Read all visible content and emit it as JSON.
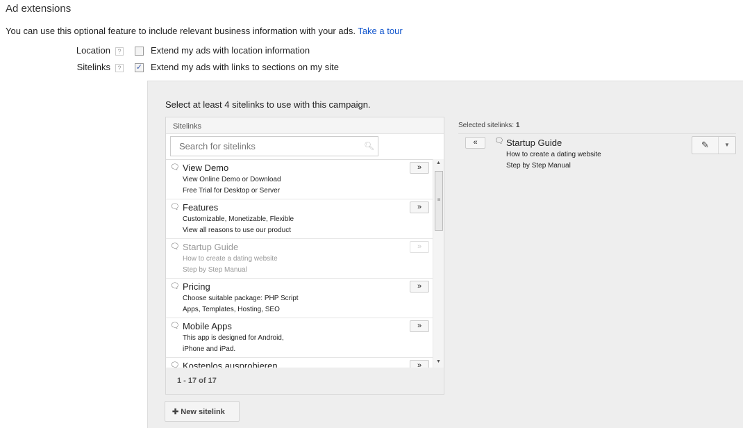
{
  "header": {
    "title": "Ad extensions",
    "description": "You can use this optional feature to include relevant business information with your ads.",
    "tour_link": "Take a tour"
  },
  "options": [
    {
      "label": "Location",
      "help": "?",
      "checked": false,
      "text": "Extend my ads with location information"
    },
    {
      "label": "Sitelinks",
      "help": "?",
      "checked": true,
      "text": "Extend my ads with links to sections on my site"
    }
  ],
  "sitelinks_panel": {
    "instruction": "Select at least 4 sitelinks to use with this campaign.",
    "box_title": "Sitelinks",
    "search_placeholder": "Search for sitelinks",
    "add_label": "»",
    "items": [
      {
        "title": "View Demo",
        "line1": "View Online Demo or Download",
        "line2": "Free Trial for Desktop or Server",
        "disabled": false
      },
      {
        "title": "Features",
        "line1": "Customizable, Monetizable, Flexible",
        "line2": "View all reasons to use our product",
        "disabled": false
      },
      {
        "title": "Startup Guide",
        "line1": "How to create a dating website",
        "line2": "Step by Step Manual",
        "disabled": true
      },
      {
        "title": "Pricing",
        "line1": "Choose suitable package: PHP Script",
        "line2": "Apps, Templates, Hosting, SEO",
        "disabled": false
      },
      {
        "title": "Mobile Apps",
        "line1": "This app is designed for Android,",
        "line2": "iPhone and iPad.",
        "disabled": false
      },
      {
        "title": "Kostenlos ausprobieren",
        "line1": "",
        "line2": "",
        "disabled": false
      }
    ],
    "pagination": "1 - 17 of 17",
    "new_sitelink": "New sitelink"
  },
  "selected": {
    "label": "Selected sitelinks:",
    "count": "1",
    "remove_label": "«",
    "items": [
      {
        "title": "Startup Guide",
        "line1": "How to create a dating website",
        "line2": "Step by Step Manual"
      }
    ]
  }
}
